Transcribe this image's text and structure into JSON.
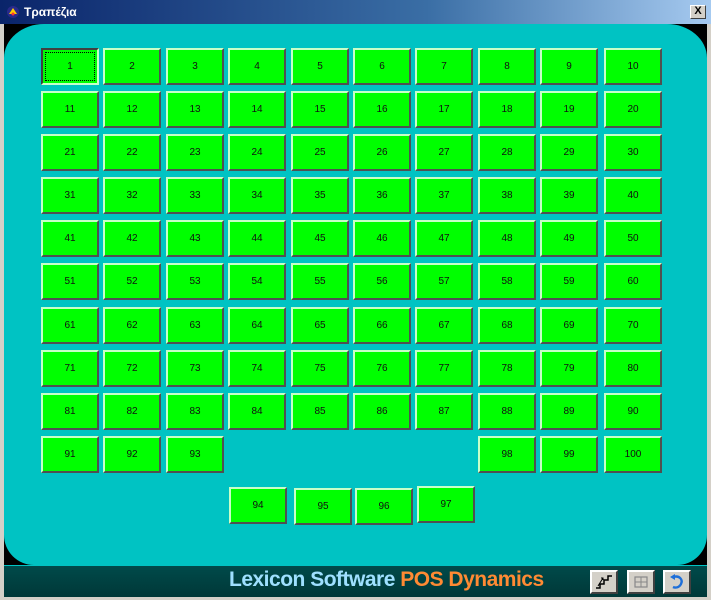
{
  "window": {
    "title": "Τραπέζια",
    "close_label": "X"
  },
  "tables": {
    "selected": "1",
    "grid_rows": [
      [
        "1",
        "2",
        "3",
        "4",
        "5",
        "6",
        "7",
        "8",
        "9",
        "10"
      ],
      [
        "11",
        "12",
        "13",
        "14",
        "15",
        "16",
        "17",
        "18",
        "19",
        "20"
      ],
      [
        "21",
        "22",
        "23",
        "24",
        "25",
        "26",
        "27",
        "28",
        "29",
        "30"
      ],
      [
        "31",
        "32",
        "33",
        "34",
        "35",
        "36",
        "37",
        "38",
        "39",
        "40"
      ],
      [
        "41",
        "42",
        "43",
        "44",
        "45",
        "46",
        "47",
        "48",
        "49",
        "50"
      ],
      [
        "51",
        "52",
        "53",
        "54",
        "55",
        "56",
        "57",
        "58",
        "59",
        "60"
      ],
      [
        "61",
        "62",
        "63",
        "64",
        "65",
        "66",
        "67",
        "68",
        "69",
        "70"
      ],
      [
        "71",
        "72",
        "73",
        "74",
        "75",
        "76",
        "77",
        "78",
        "79",
        "80"
      ],
      [
        "81",
        "82",
        "83",
        "84",
        "85",
        "86",
        "87",
        "88",
        "89",
        "90"
      ]
    ],
    "row10_left": [
      "91",
      "92",
      "93"
    ],
    "row10_right": [
      "98",
      "99",
      "100"
    ],
    "bottom_group": [
      "94",
      "95",
      "96",
      "97"
    ]
  },
  "footer": {
    "brand_primary": "Lexicon Software",
    "brand_secondary": "POS Dynamics",
    "buttons": [
      {
        "icon": "stairs-icon"
      },
      {
        "icon": "table-icon"
      },
      {
        "icon": "undo-arrow-icon"
      }
    ]
  },
  "colors": {
    "table_green": "#00ff00",
    "panel_teal": "#00c3c3",
    "footer_dark": "#004040",
    "brand_blue": "#9ee0ff",
    "brand_orange": "#ff8a33"
  }
}
